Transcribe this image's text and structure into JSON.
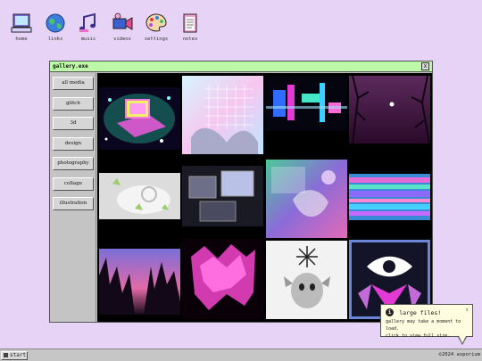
{
  "desktop": {
    "icons": [
      {
        "label": "home",
        "icon": "computer-icon"
      },
      {
        "label": "links",
        "icon": "globe-icon"
      },
      {
        "label": "music",
        "icon": "music-notes-icon"
      },
      {
        "label": "videos",
        "icon": "video-camera-icon"
      },
      {
        "label": "settings",
        "icon": "palette-icon"
      },
      {
        "label": "notes",
        "icon": "notepad-icon"
      }
    ]
  },
  "window": {
    "title": "gallery.exe",
    "close_label": "x",
    "titlebar_color": "#bdf7a8"
  },
  "sidebar": {
    "items": [
      {
        "label": "all media"
      },
      {
        "label": "glitch"
      },
      {
        "label": "3d"
      },
      {
        "label": "design"
      },
      {
        "label": "photography"
      },
      {
        "label": "collage"
      },
      {
        "label": "illustration"
      }
    ]
  },
  "tooltip": {
    "icon": "info-icon",
    "title": "large files!",
    "close_label": "x",
    "line1": "gallery may take a moment to load.",
    "line2": "click to view full size."
  },
  "taskbar": {
    "start_label": "start",
    "copyright": "©2024 avporium"
  }
}
